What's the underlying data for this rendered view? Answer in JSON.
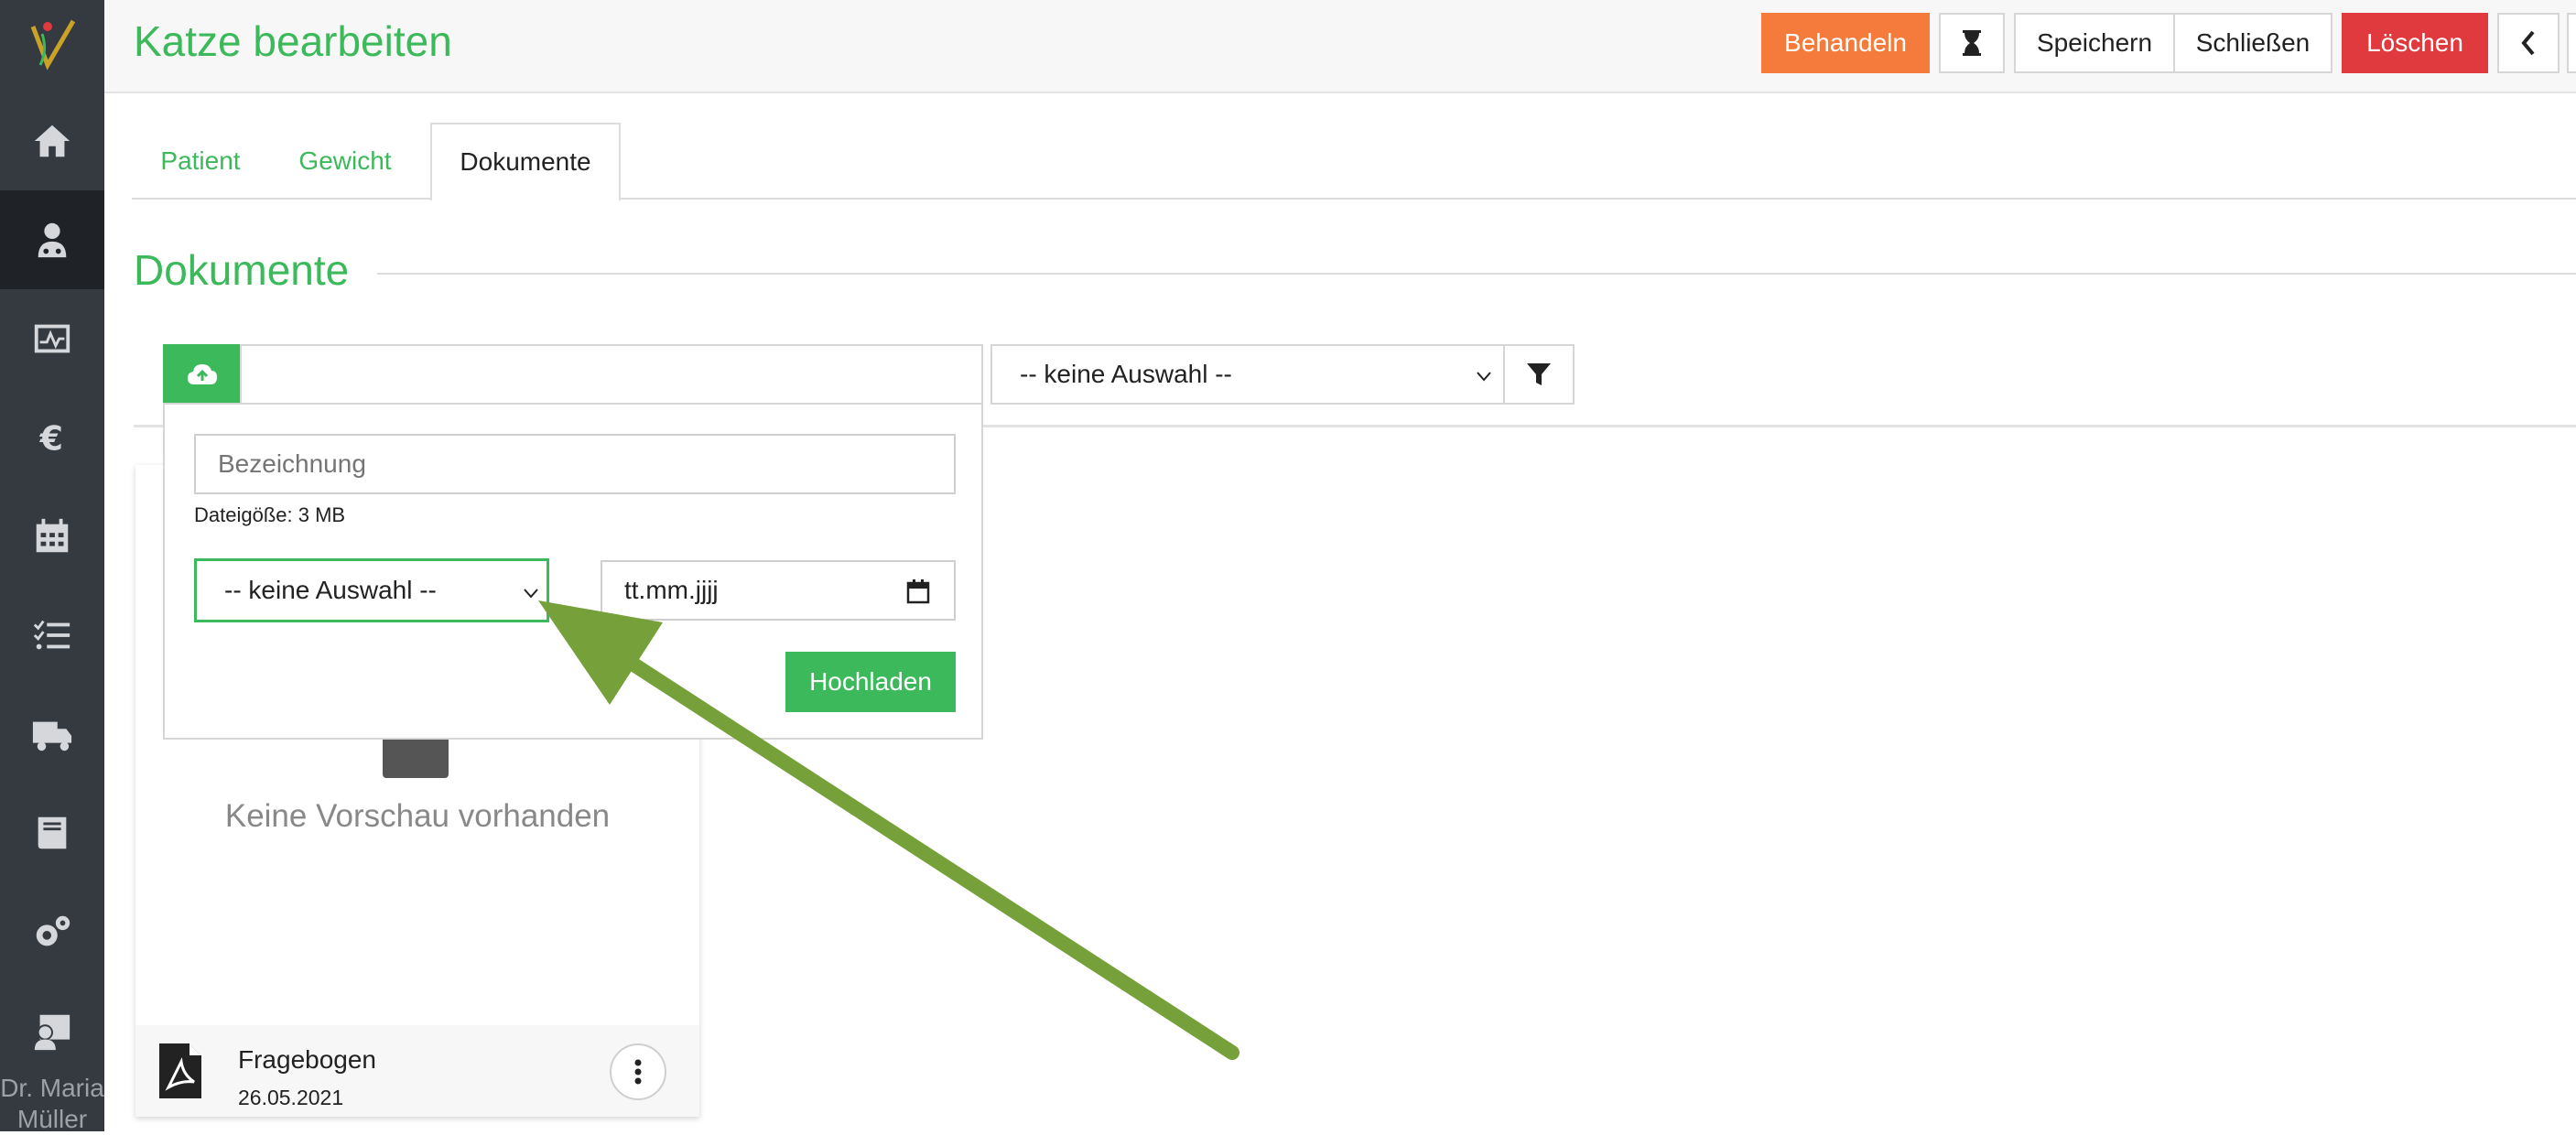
{
  "header": {
    "title": "Katze bearbeiten",
    "buttons": {
      "treat": "Behandeln",
      "save": "Speichern",
      "close": "Schließen",
      "delete": "Löschen"
    }
  },
  "tabs": [
    "Patient",
    "Gewicht",
    "Dokumente"
  ],
  "section": {
    "title": "Dokumente"
  },
  "toolbar": {
    "filter_value": "-- keine Auswahl --"
  },
  "upload_form": {
    "name_placeholder": "Bezeichnung",
    "size_note": "Dateigöße: 3 MB",
    "category_value": "-- keine Auswahl --",
    "date_value": "tt.mm.jjjj",
    "submit_label": "Hochladen"
  },
  "card": {
    "preview_text": "Keine Vorschau vorhanden",
    "doc_name": "Fragebogen",
    "doc_date": "26.05.2021"
  },
  "sidebar": {
    "user_name": "Dr. Maria Müller"
  },
  "colors": {
    "accent": "#3cb95a",
    "orange": "#f47b3b",
    "red": "#e0393e",
    "sidebar": "#343a40",
    "arrow": "#76a13a"
  }
}
